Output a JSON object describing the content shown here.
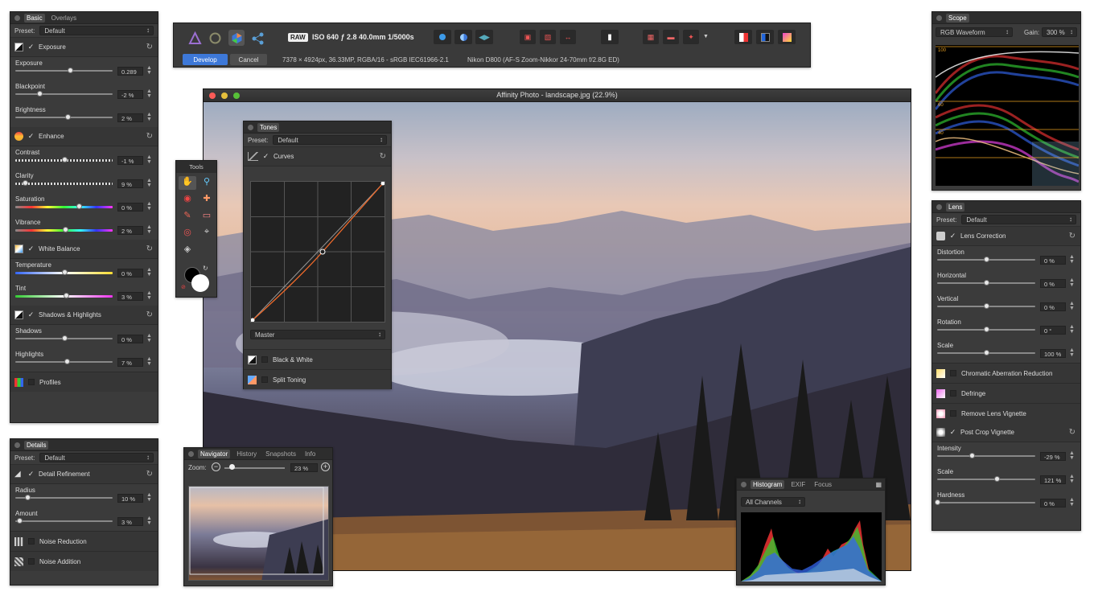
{
  "colors": {
    "accent": "#3d78d8",
    "panel": "#3b3b3b",
    "curve": "#f06a2a"
  },
  "toolbar": {
    "raw_badge": "RAW",
    "exif": "ISO 640 ƒ 2.8 40.0mm 1/5000s",
    "develop": "Develop",
    "cancel": "Cancel",
    "image_info": "7378 × 4924px, 36.33MP, RGBA/16 - sRGB IEC61966-2.1",
    "camera_info": "Nikon D800 (AF-S Zoom-Nikkor 24-70mm f/2.8G ED)"
  },
  "window": {
    "title": "Affinity Photo - landscape.jpg (22.9%)"
  },
  "basic": {
    "tabs": [
      "Basic",
      "Overlays"
    ],
    "preset_label": "Preset:",
    "preset_value": "Default",
    "exposure_title": "Exposure",
    "exposure": {
      "label": "Exposure",
      "value": "0.289",
      "pos": 0.56
    },
    "blackpoint": {
      "label": "Blackpoint",
      "value": "-2 %",
      "pos": 0.25
    },
    "brightness": {
      "label": "Brightness",
      "value": "2 %",
      "pos": 0.54
    },
    "enhance_title": "Enhance",
    "contrast": {
      "label": "Contrast",
      "value": "-1 %",
      "pos": 0.5
    },
    "clarity": {
      "label": "Clarity",
      "value": "9 %",
      "pos": 0.1
    },
    "saturation": {
      "label": "Saturation",
      "value": "0 %",
      "pos": 0.65
    },
    "vibrance": {
      "label": "Vibrance",
      "value": "2 %",
      "pos": 0.51
    },
    "wb_title": "White Balance",
    "temperature": {
      "label": "Temperature",
      "value": "0 %",
      "pos": 0.5
    },
    "tint": {
      "label": "Tint",
      "value": "3 %",
      "pos": 0.52
    },
    "sh_title": "Shadows & Highlights",
    "shadows": {
      "label": "Shadows",
      "value": "0 %",
      "pos": 0.5
    },
    "highlights": {
      "label": "Highlights",
      "value": "7 %",
      "pos": 0.53
    },
    "profiles": "Profiles"
  },
  "details": {
    "tab": "Details",
    "preset_label": "Preset:",
    "preset_value": "Default",
    "refinement": "Detail Refinement",
    "radius": {
      "label": "Radius",
      "value": "10 %",
      "pos": 0.12
    },
    "amount": {
      "label": "Amount",
      "value": "3 %",
      "pos": 0.04
    },
    "noise_reduction": "Noise Reduction",
    "noise_addition": "Noise Addition"
  },
  "tools": {
    "title": "Tools"
  },
  "tones": {
    "tab": "Tones",
    "preset_label": "Preset:",
    "preset_value": "Default",
    "curves": "Curves",
    "channel": "Master",
    "bw": "Black & White",
    "split": "Split Toning"
  },
  "navigator": {
    "tabs": [
      "Navigator",
      "History",
      "Snapshots",
      "Info"
    ],
    "zoom_label": "Zoom:",
    "zoom_value": "23 %"
  },
  "histogram": {
    "tabs": [
      "Histogram",
      "EXIF",
      "Focus"
    ],
    "channel": "All Channels"
  },
  "scope": {
    "tab": "Scope",
    "mode": "RGB Waveform",
    "gain_label": "Gain:",
    "gain": "300 %",
    "ticks": [
      "100",
      "60",
      "40"
    ]
  },
  "lens": {
    "tab": "Lens",
    "preset_label": "Preset:",
    "preset_value": "Default",
    "correction": "Lens Correction",
    "distortion": {
      "label": "Distortion",
      "value": "0 %",
      "pos": 0.5
    },
    "horizontal": {
      "label": "Horizontal",
      "value": "0 %",
      "pos": 0.5
    },
    "vertical": {
      "label": "Vertical",
      "value": "0 %",
      "pos": 0.5
    },
    "rotation": {
      "label": "Rotation",
      "value": "0 °",
      "pos": 0.5
    },
    "scale": {
      "label": "Scale",
      "value": "100 %",
      "pos": 0.5
    },
    "chromatic": "Chromatic Aberration Reduction",
    "defringe": "Defringe",
    "vignette": "Remove Lens Vignette",
    "post_crop": "Post Crop Vignette",
    "intensity": {
      "label": "Intensity",
      "value": "-29 %",
      "pos": 0.35
    },
    "scale2": {
      "label": "Scale",
      "value": "121 %",
      "pos": 0.61
    },
    "hardness": {
      "label": "Hardness",
      "value": "0 %",
      "pos": 0.0
    }
  }
}
